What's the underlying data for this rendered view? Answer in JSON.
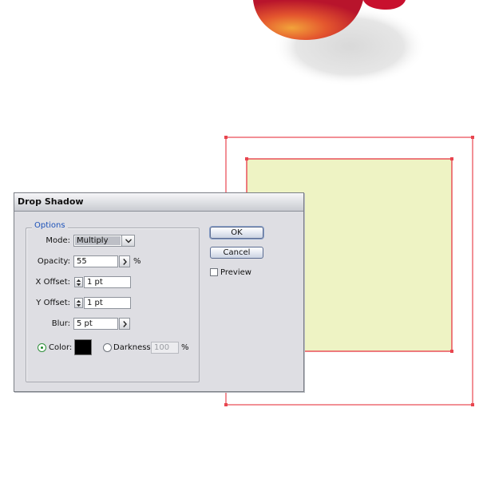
{
  "dialog": {
    "title": "Drop Shadow",
    "options_group_label": "Options",
    "mode": {
      "label": "Mode:",
      "value": "Multiply",
      "icon": "chevron-down-icon"
    },
    "opacity": {
      "label": "Opacity:",
      "value": "55",
      "unit": "%",
      "icon": "chevron-right-icon"
    },
    "x_offset": {
      "label": "X Offset:",
      "value": "1 pt",
      "icon": "spinner-icon"
    },
    "y_offset": {
      "label": "Y Offset:",
      "value": "1 pt",
      "icon": "spinner-icon"
    },
    "blur": {
      "label": "Blur:",
      "value": "5 pt",
      "icon": "chevron-right-icon"
    },
    "color_option": {
      "label": "Color:",
      "selected": true,
      "swatch": "#000000"
    },
    "darkness_option": {
      "label": "Darkness:",
      "selected": false,
      "value": "100",
      "unit": "%"
    },
    "ok_label": "OK",
    "cancel_label": "Cancel",
    "preview": {
      "label": "Preview",
      "checked": false
    }
  },
  "artwork": {
    "square_fill": "#eef3c4",
    "selection_color": "#e8454f",
    "fruit_colors": [
      "#c8102e",
      "#e4572e",
      "#f2a33a"
    ]
  }
}
